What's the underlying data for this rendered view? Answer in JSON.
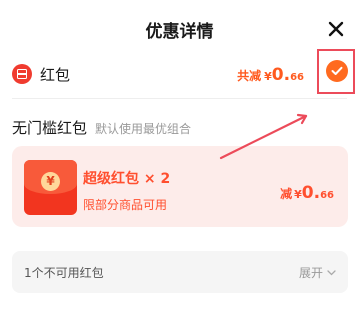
{
  "header": {
    "title": "优惠详情",
    "close_icon": "close-icon"
  },
  "red_packet": {
    "label": "红包",
    "total_label": "共减",
    "currency": "¥",
    "amount_int": "0.",
    "amount_dec": "66",
    "checked": true,
    "accent": "#ff6a1f"
  },
  "section": {
    "title": "无门槛红包",
    "subtitle": "默认使用最优组合"
  },
  "coupon": {
    "icon_glyph": "¥",
    "title": "超级红包 × 2",
    "description": "限部分商品可用",
    "deduct_label": "减",
    "currency": "¥",
    "amount_int": "0.",
    "amount_dec": "66",
    "background": "#fdecea",
    "accent": "#ff4f2f"
  },
  "unavailable": {
    "label": "1个不可用红包",
    "expand_label": "展开"
  },
  "highlight_color": "#ec4b5a"
}
